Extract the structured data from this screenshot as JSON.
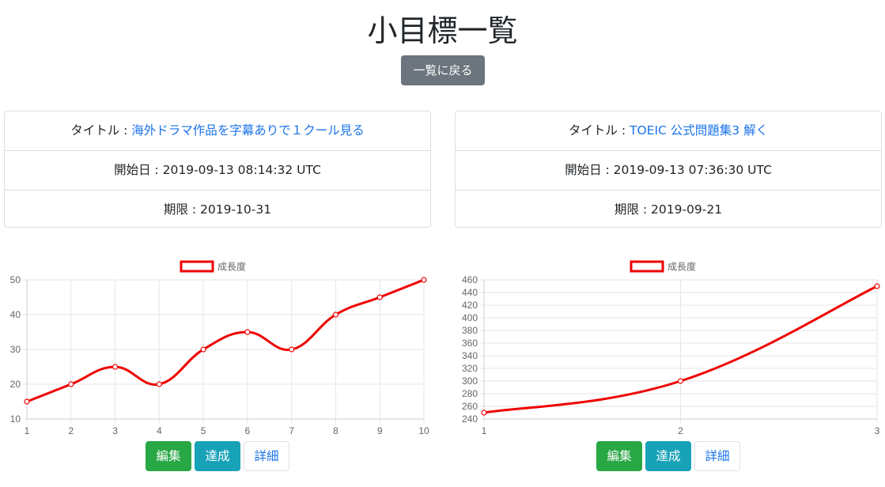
{
  "header": {
    "title": "小目標一覧",
    "back_label": "一覧に戻る"
  },
  "goals": [
    {
      "title_prefix": "タイトル : ",
      "title_link": "海外ドラマ作品を字幕ありで１クール見る",
      "start": "開始日 : 2019-09-13 08:14:32 UTC",
      "deadline": "期限 : 2019-10-31",
      "buttons": {
        "edit": "編集",
        "done": "達成",
        "detail": "詳細"
      }
    },
    {
      "title_prefix": "タイトル : ",
      "title_link": "TOEIC 公式問題集3 解く",
      "start": "開始日 : 2019-09-13 07:36:30 UTC",
      "deadline": "期限 : 2019-09-21",
      "buttons": {
        "edit": "編集",
        "done": "達成",
        "detail": "詳細"
      }
    }
  ],
  "colors": {
    "line": "#ee0000",
    "grid": "#e6e6e6",
    "tick": "#666666"
  },
  "chart_data": [
    {
      "type": "line",
      "x": [
        1,
        2,
        3,
        4,
        5,
        6,
        7,
        8,
        9,
        10
      ],
      "series": [
        {
          "name": "成長度",
          "values": [
            15,
            20,
            25,
            20,
            30,
            35,
            30,
            40,
            45,
            50
          ]
        }
      ],
      "ylim": [
        10,
        50
      ],
      "yticks": [
        10,
        20,
        30,
        40,
        50
      ],
      "xticks": [
        "1",
        "2",
        "3",
        "4",
        "5",
        "6",
        "7",
        "8",
        "9",
        "10"
      ],
      "grid": true,
      "legend": "top-center"
    },
    {
      "type": "line",
      "x": [
        1,
        2,
        3
      ],
      "series": [
        {
          "name": "成長度",
          "values": [
            250,
            300,
            450
          ]
        }
      ],
      "ylim": [
        240,
        460
      ],
      "yticks": [
        240,
        260,
        280,
        300,
        320,
        340,
        360,
        380,
        400,
        420,
        440,
        460
      ],
      "xticks": [
        "1",
        "2",
        "3"
      ],
      "grid": true,
      "legend": "top-center"
    }
  ]
}
